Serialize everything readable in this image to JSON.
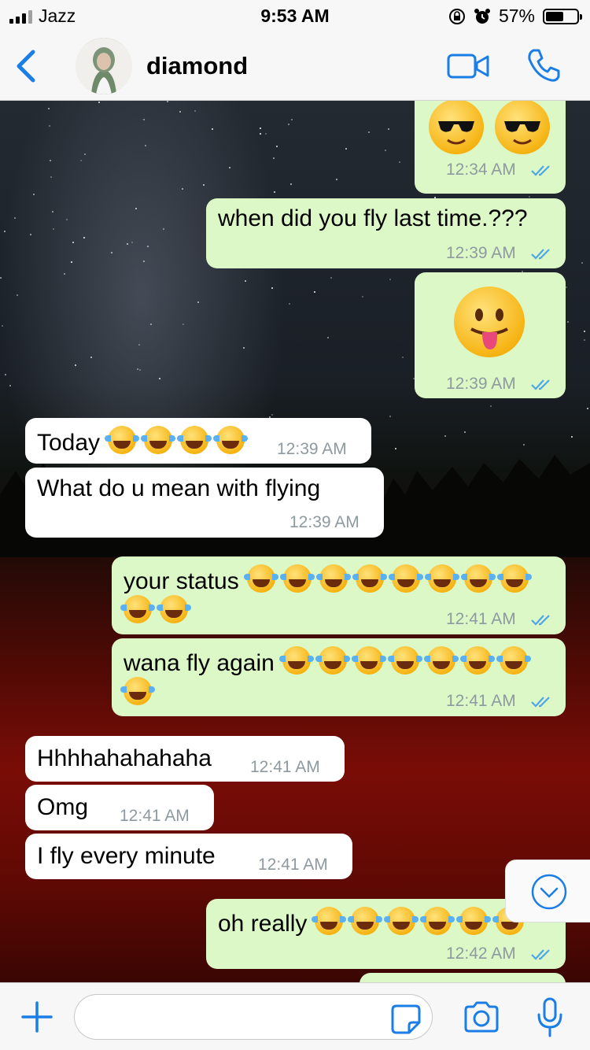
{
  "status_bar": {
    "carrier": "Jazz",
    "time": "9:53 AM",
    "battery": "57%",
    "battery_level": 0.57
  },
  "header": {
    "contact_name": "diamond"
  },
  "messages": [
    {
      "id": "m1",
      "dir": "out",
      "emoji": [
        "sunglasses",
        "sunglasses"
      ],
      "time": "12:34 AM",
      "read": true
    },
    {
      "id": "m2",
      "dir": "out",
      "text": "when did you fly last time.???",
      "time": "12:39 AM",
      "read": true
    },
    {
      "id": "m3",
      "dir": "out",
      "emoji": [
        "tongue"
      ],
      "time": "12:39 AM",
      "read": true
    },
    {
      "id": "m4",
      "dir": "in",
      "text": "Today",
      "emoji_count": 4,
      "time": "12:39 AM"
    },
    {
      "id": "m5",
      "dir": "in",
      "text": "What do u mean with flying",
      "time": "12:39 AM"
    },
    {
      "id": "m6",
      "dir": "out",
      "text": "your status",
      "emoji_count": 10,
      "time": "12:41 AM",
      "read": true
    },
    {
      "id": "m7",
      "dir": "out",
      "text": "wana fly again",
      "emoji_count": 8,
      "time": "12:41 AM",
      "read": true
    },
    {
      "id": "m8",
      "dir": "in",
      "text": "Hhhhahahahaha",
      "time": "12:41 AM"
    },
    {
      "id": "m9",
      "dir": "in",
      "text": "Omg",
      "time": "12:41 AM"
    },
    {
      "id": "m10",
      "dir": "in",
      "text": "I fly every minute",
      "time": "12:41 AM"
    },
    {
      "id": "m11",
      "dir": "out",
      "text": "oh really",
      "emoji_count": 6,
      "time": "12:42 AM",
      "read": true
    }
  ],
  "input": {
    "value": "",
    "placeholder": ""
  },
  "colors": {
    "accent": "#1a7ee6",
    "outgoing": "#dcf8c6",
    "incoming": "#ffffff",
    "read_ticks": "#4fa6e8"
  }
}
